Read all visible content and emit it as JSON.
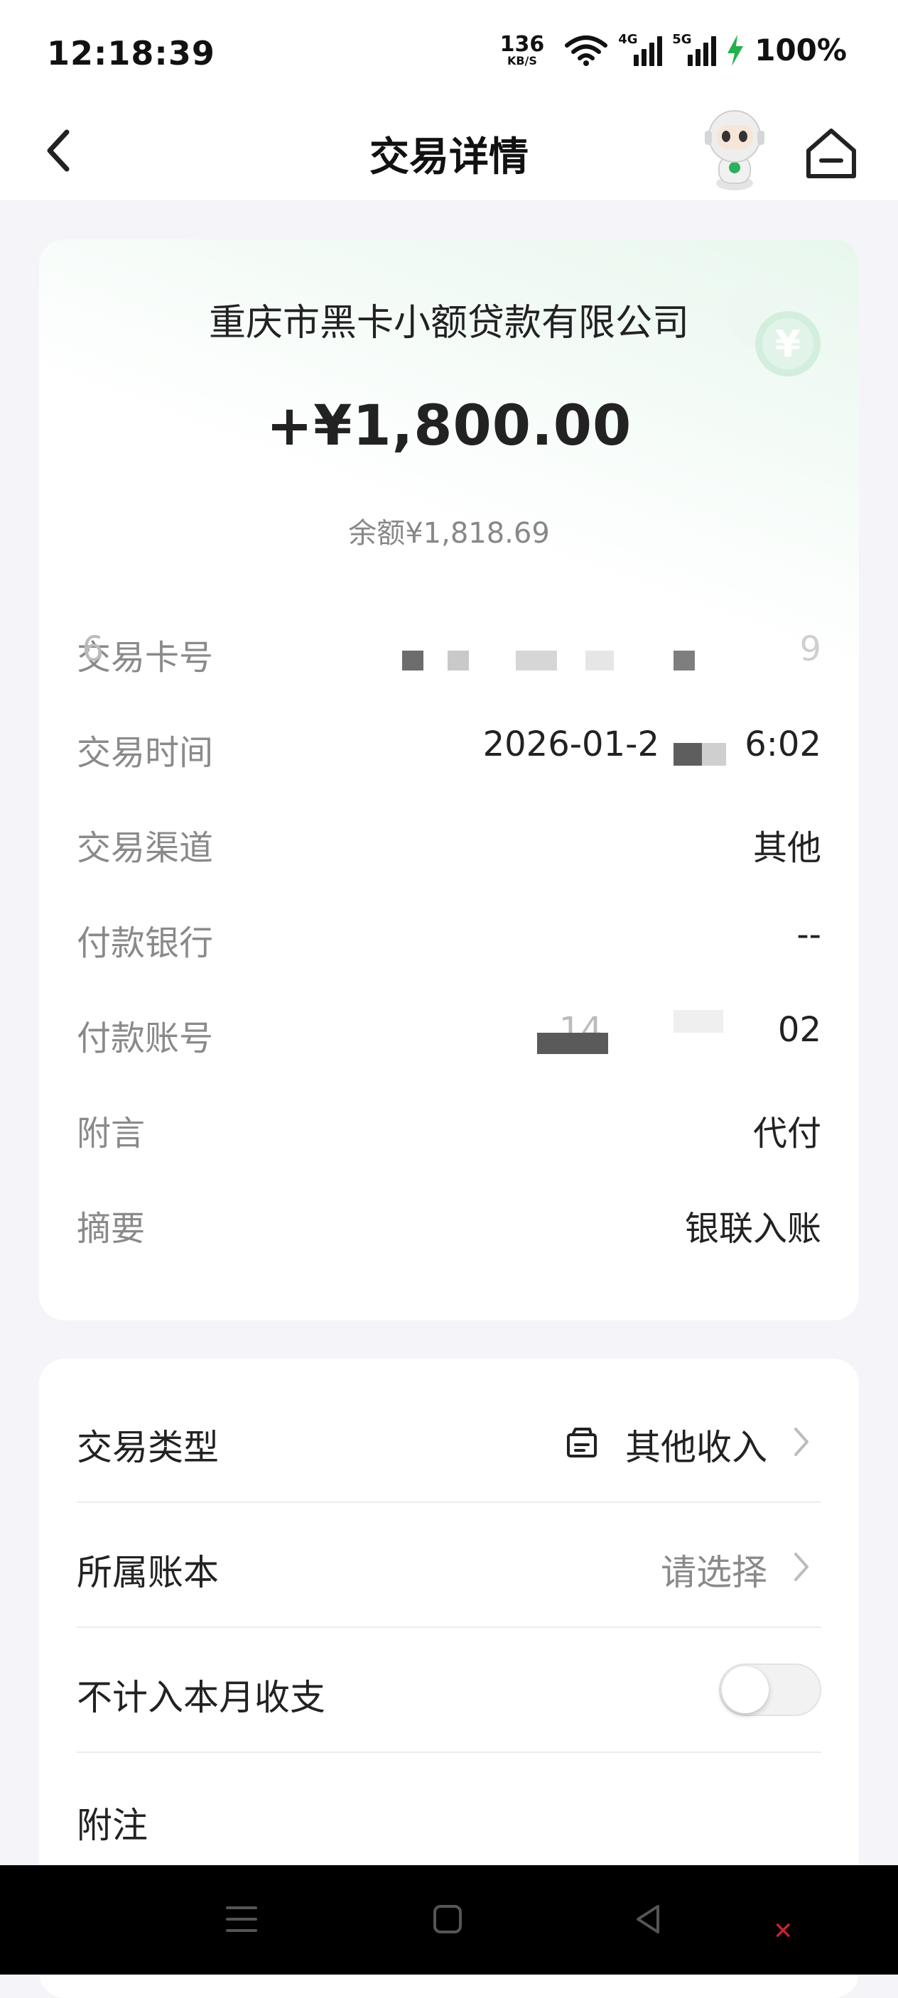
{
  "status_bar": {
    "time": "12:18:39",
    "net_speed_value": "136",
    "net_speed_unit": "KB/S",
    "sim1_label": "4G",
    "sim2_label": "5G",
    "battery": "100%"
  },
  "nav": {
    "title": "交易详情"
  },
  "transaction": {
    "counterparty": "重庆市黑卡小额贷款有限公司",
    "amount": "+¥1,800.00",
    "balance": "余额¥1,818.69",
    "rows": [
      {
        "label": "交易卡号",
        "value": "6",
        "value_tail": "9"
      },
      {
        "label": "交易时间",
        "value": "2026-01-2",
        "value_tail": "6:02"
      },
      {
        "label": "交易渠道",
        "value": "其他"
      },
      {
        "label": "付款银行",
        "value": "--"
      },
      {
        "label": "付款账号",
        "value": "14",
        "value_tail": "02"
      },
      {
        "label": "附言",
        "value": "代付"
      },
      {
        "label": "摘要",
        "value": "银联入账"
      }
    ]
  },
  "settings": {
    "type_label": "交易类型",
    "type_value": "其他收入",
    "ledger_label": "所属账本",
    "ledger_value": "请选择",
    "exclude_label": "不计入本月收支",
    "exclude_on": false,
    "note_label": "附注"
  },
  "colors": {
    "accent_green": "#2bb05e",
    "background": "#f4f4f9"
  }
}
